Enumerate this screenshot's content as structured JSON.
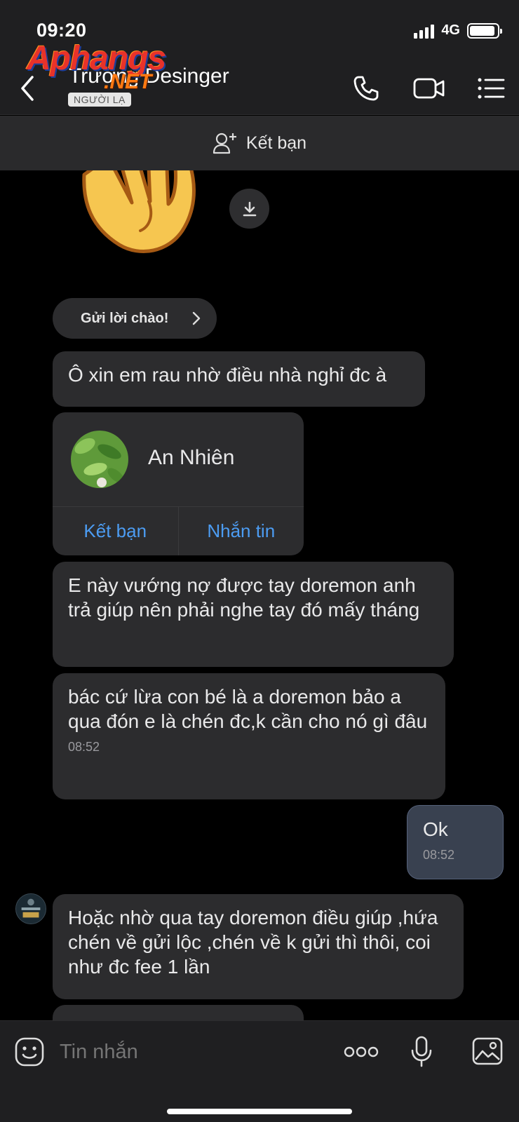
{
  "status_bar": {
    "time": "09:20",
    "network": "4G",
    "battery_level": 0.92
  },
  "header": {
    "contact_name": "Trường Desinger",
    "stranger_badge": "NGƯỜI LẠ",
    "icons": [
      "back-chevron-icon",
      "phone-icon",
      "video-call-icon",
      "menu-list-icon"
    ]
  },
  "watermark": {
    "main": "Aphangs",
    "sub": ".NET"
  },
  "add_friend_bar": {
    "label": "Kết bạn",
    "icon": "add-user-icon"
  },
  "chat": {
    "sticker": "waving-hand-sticker",
    "greeting_button": "Gửi lời chào!",
    "messages": [
      {
        "from": "peer",
        "text": "Ô xin em rau nhờ điều nhà nghỉ đc à"
      },
      {
        "from": "peer",
        "type": "contact_card",
        "name": "An Nhiên",
        "actions": [
          "Kết bạn",
          "Nhắn tin"
        ]
      },
      {
        "from": "peer",
        "text": "E này vướng nợ được tay doremon anh trả giúp nên phải nghe tay đó mấy tháng"
      },
      {
        "from": "peer",
        "text": "bác cứ lừa con bé là a doremon bảo a qua đón e là chén đc,k cần cho nó gì đâu",
        "time": "08:52"
      },
      {
        "from": "me",
        "text": "Ok",
        "time": "08:52"
      },
      {
        "from": "peer",
        "text": "Hoặc nhờ qua tay doremon điều giúp ,hứa chén về gửi lộc ,chén về k gửi thì thôi, coi như đc fee 1 lần"
      }
    ]
  },
  "composer": {
    "placeholder": "Tin nhắn",
    "icons": [
      "emoji-icon",
      "more-icon",
      "microphone-icon",
      "image-icon"
    ]
  },
  "colors": {
    "background": "#000000",
    "bubble_peer": "#2c2c2e",
    "bubble_mine": "#394150",
    "link_blue": "#4c9cf2"
  }
}
